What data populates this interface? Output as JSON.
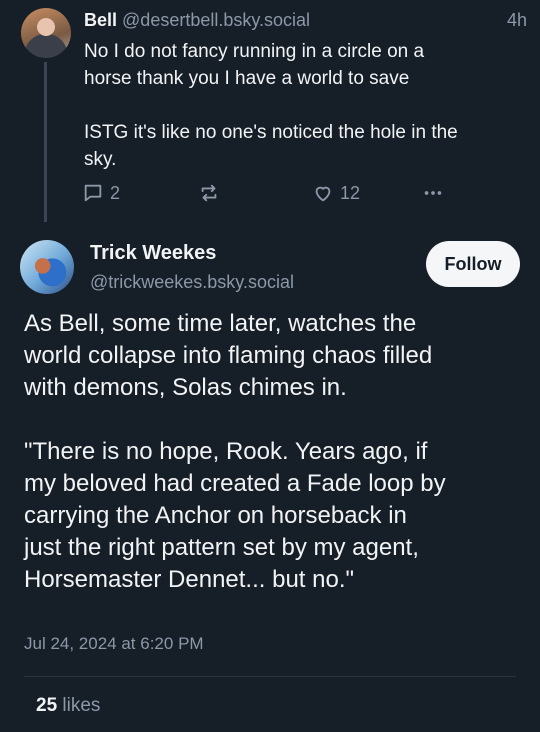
{
  "parent_post": {
    "display_name": "Bell",
    "handle": "@desertbell.bsky.social",
    "time": "4h",
    "text": "No I do not fancy running in a circle on a\nhorse thank you I have a world to save\n\nISTG it's like no one's noticed the hole in the\nsky.",
    "reply_count": "2",
    "like_count": "12",
    "icons": {
      "reply": "reply-bubble-icon",
      "repost": "repost-arrows-icon",
      "like": "heart-icon",
      "more": "ellipsis-icon"
    }
  },
  "main_post": {
    "display_name": "Trick Weekes",
    "handle": "@trickweekes.bsky.social",
    "follow_label": "Follow",
    "text": "As Bell, some time later, watches the\nworld collapse into flaming chaos filled\nwith demons, Solas chimes in.\n\n\"There is no hope, Rook. Years ago, if\nmy beloved had created a Fade loop by\ncarrying the Anchor on horseback in\njust the right pattern set by my agent,\nHorsemaster Dennet... but no.\"",
    "timestamp": "Jul 24, 2024 at 6:20 PM",
    "likes_count": "25",
    "likes_label": "likes"
  },
  "colors": {
    "background": "#161e27",
    "text_primary": "#f1f3f5",
    "text_secondary": "#8b98a8",
    "follow_bg": "#f4f6f8"
  }
}
